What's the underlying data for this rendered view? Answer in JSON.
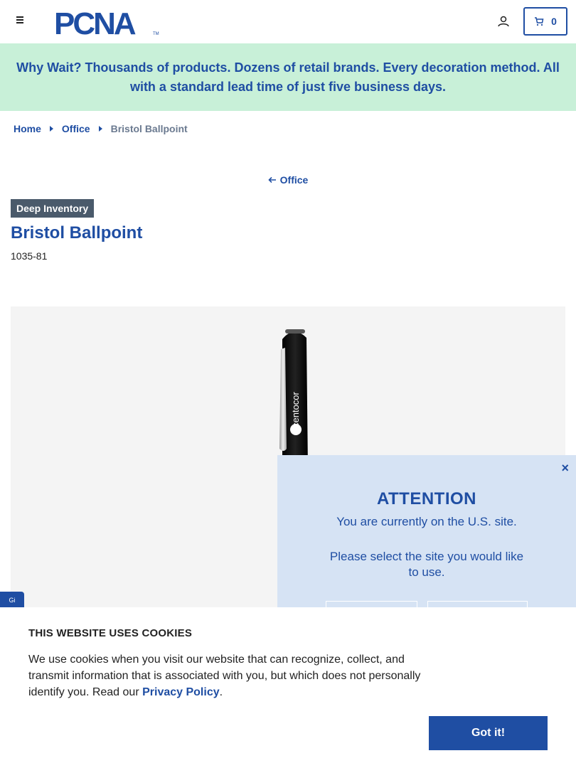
{
  "header": {
    "logo_text": "PCNA",
    "cart_count": "0",
    "brand_color": "#1f4ea3"
  },
  "promo": {
    "text": "Why Wait? Thousands of products. Dozens of retail brands. Every decoration method. All with a standard lead time of just five business days.",
    "background": "#c8f0d8"
  },
  "breadcrumb": {
    "items": [
      "Home",
      "Office"
    ],
    "current": "Bristol Ballpoint"
  },
  "back_link": {
    "label": "Office"
  },
  "product": {
    "badge": "Deep Inventory",
    "title": "Bristol Ballpoint",
    "sku": "1035-81",
    "imprint_text": "centocor"
  },
  "side_tab": {
    "label": "Gi"
  },
  "popup": {
    "title": "ATTENTION",
    "line1": "You are currently on the U.S. site.",
    "line2": "Please select the site you would like to use.",
    "close": "×"
  },
  "cookie": {
    "title": "THIS WEBSITE USES COOKIES",
    "text_before": "We use cookies when you visit our website that can recognize, collect, and transmit information that is associated with you, but which does not personally identify you. Read our ",
    "link": "Privacy Policy",
    "text_after": ".",
    "button": "Got it!"
  }
}
